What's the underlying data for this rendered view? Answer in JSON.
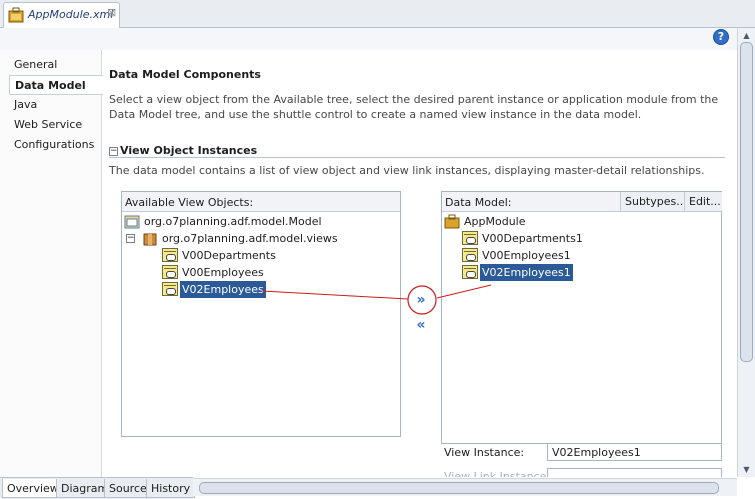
{
  "editor_tab": {
    "title": "AppModule.xml",
    "close": "⊠"
  },
  "help_icon": "?",
  "nav": [
    "General",
    "Data Model",
    "Java",
    "Web Service",
    "Configurations"
  ],
  "section": {
    "title": "Data Model Components",
    "description": "Select a view object from the Available tree, select the desired parent instance or application module from the Data Model tree, and use the shuttle control to create a named view instance in the data model.",
    "sub_title": "View Object Instances",
    "sub_toggle": "−",
    "sub_description": "The data model contains a list of view object and view link instances, displaying master-detail relationships."
  },
  "available": {
    "header": "Available View Objects:",
    "root": "org.o7planning.adf.model.Model",
    "package": "org.o7planning.adf.model.views",
    "expander": "−",
    "items": [
      "V00Departments",
      "V00Employees",
      "V02Employees"
    ]
  },
  "data_model": {
    "header": "Data Model:",
    "subtypes_button": "Subtypes...",
    "edit_button": "Edit...",
    "root": "AppModule",
    "items": [
      "V00Departments1",
      "V00Employees1",
      "V02Employees1"
    ]
  },
  "shuttle": {
    "add": "»",
    "remove": "«"
  },
  "view_instance": {
    "label": "View Instance:",
    "value": "V02Employees1"
  },
  "view_link_instance": {
    "label": "View Link Instance:"
  },
  "bottom_tabs": [
    "Overview",
    "Diagram",
    "Source",
    "History"
  ],
  "colors": {
    "selection": "#2a5b98",
    "annotation": "#d01a1a",
    "shuttle": "#2d6ecf"
  }
}
